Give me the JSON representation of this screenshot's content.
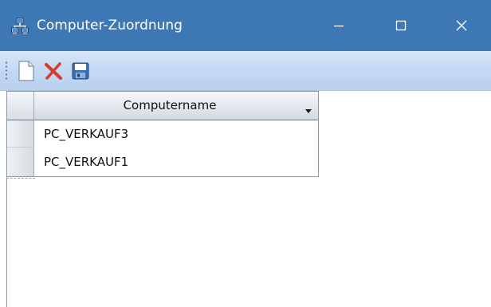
{
  "window": {
    "title": "Computer-Zuordnung",
    "app_icon": "network-computers-icon",
    "titlebar_color": "#3d78b4",
    "controls": [
      "minimize-icon",
      "maximize-icon",
      "close-icon"
    ]
  },
  "toolbar": {
    "items": [
      {
        "name": "new",
        "icon": "new-document-icon"
      },
      {
        "name": "delete",
        "icon": "delete-x-icon",
        "color": "#d93a2a"
      },
      {
        "name": "save",
        "icon": "floppy-disk-icon"
      }
    ]
  },
  "grid": {
    "columns": [
      {
        "header": "Computername",
        "has_filter": true
      }
    ],
    "rows": [
      {
        "computername": "PC_VERKAUF3"
      },
      {
        "computername": "PC_VERKAUF1"
      }
    ]
  }
}
